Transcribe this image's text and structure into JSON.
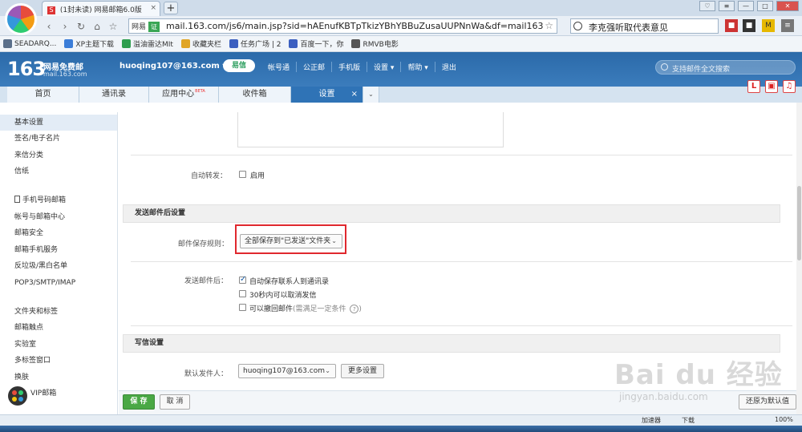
{
  "browser": {
    "tab_favicon": "S",
    "tab_title": "(1封未读) 网易邮箱6.0版",
    "tab_close": "×",
    "new_tab": "+",
    "url_site_label": "网易",
    "url_site_badge": "证",
    "url": "mail.163.com/js6/main.jsp?sid=hAEnufKBTpTkizYBhYBBuZusaUUPNnWa&df=mail163",
    "search_text": "李克强听取代表意见",
    "bookmarks": [
      {
        "label": "SEADARQ...",
        "color": "#5a6f8a"
      },
      {
        "label": "XP主题下载",
        "color": "#3b7dd8"
      },
      {
        "label": "溢油雷达MIt",
        "color": "#2e9e4f"
      },
      {
        "label": "收藏夹栏",
        "color": "#e0a526"
      },
      {
        "label": "任务广场 | 2",
        "color": "#3b5fc0"
      },
      {
        "label": "百度一下，你",
        "color": "#3b5fc0"
      },
      {
        "label": "RMVB电影",
        "color": "#555555"
      }
    ]
  },
  "header": {
    "logo": "163",
    "logo_title": "网易免费邮",
    "logo_domain": "mail.163.com",
    "account": "huoqing107@163.com ▾",
    "yixin": "易信",
    "links": [
      "帐号通",
      "公正邮",
      "手机版",
      "设置 ▾",
      "帮助 ▾",
      "退出"
    ],
    "search_placeholder": "支持邮件全文搜索"
  },
  "tabs": {
    "home": "首页",
    "contacts": "通讯录",
    "apps": "应用中心",
    "apps_badge": "BETA",
    "inbox": "收件箱",
    "settings": "设置",
    "close": "×",
    "more": "⌄"
  },
  "sidebar": {
    "items": [
      "基本设置",
      "签名/电子名片",
      "来信分类",
      "信纸",
      "手机号码邮箱",
      "帐号与邮箱中心",
      "邮箱安全",
      "邮箱手机服务",
      "反垃圾/黑白名单",
      "POP3/SMTP/IMAP",
      "文件夹和标签",
      "邮箱触点",
      "实验室",
      "多标签窗口",
      "换肤",
      "VIP邮箱"
    ]
  },
  "content": {
    "auto_forward_label": "自动转发：",
    "auto_forward_option": "启用",
    "section_after_send": "发送邮件后设置",
    "save_rule_label": "邮件保存规则：",
    "save_rule_value": "全部保存到\"已发送\"文件夹",
    "after_send_label": "发送邮件后：",
    "after_send_options": [
      {
        "text": "自动保存联系人到通讯录",
        "checked": true
      },
      {
        "text": "30秒内可以取消发信",
        "checked": false
      },
      {
        "text": "可以撤回邮件",
        "muted": "(需满足一定条件",
        "checked": false
      }
    ],
    "help": "?",
    "help_close": ")",
    "section_compose": "写信设置",
    "default_sender_label": "默认发件人：",
    "default_sender_value": "huoqing107@163.com",
    "more_settings": "更多设置"
  },
  "actions": {
    "save": "保 存",
    "cancel": "取 消",
    "reset": "还原为默认值"
  },
  "status": {
    "accelerator": "加速器",
    "download": "下载",
    "zoom": "100%"
  },
  "watermark": {
    "main": "Bai du 经验",
    "sub": "jingyan.baidu.com"
  },
  "colors": {
    "header_blue": "#2b6aa9",
    "active_tab": "#2f73b6",
    "highlight_red": "#e0282e",
    "save_green": "#4aa845"
  }
}
